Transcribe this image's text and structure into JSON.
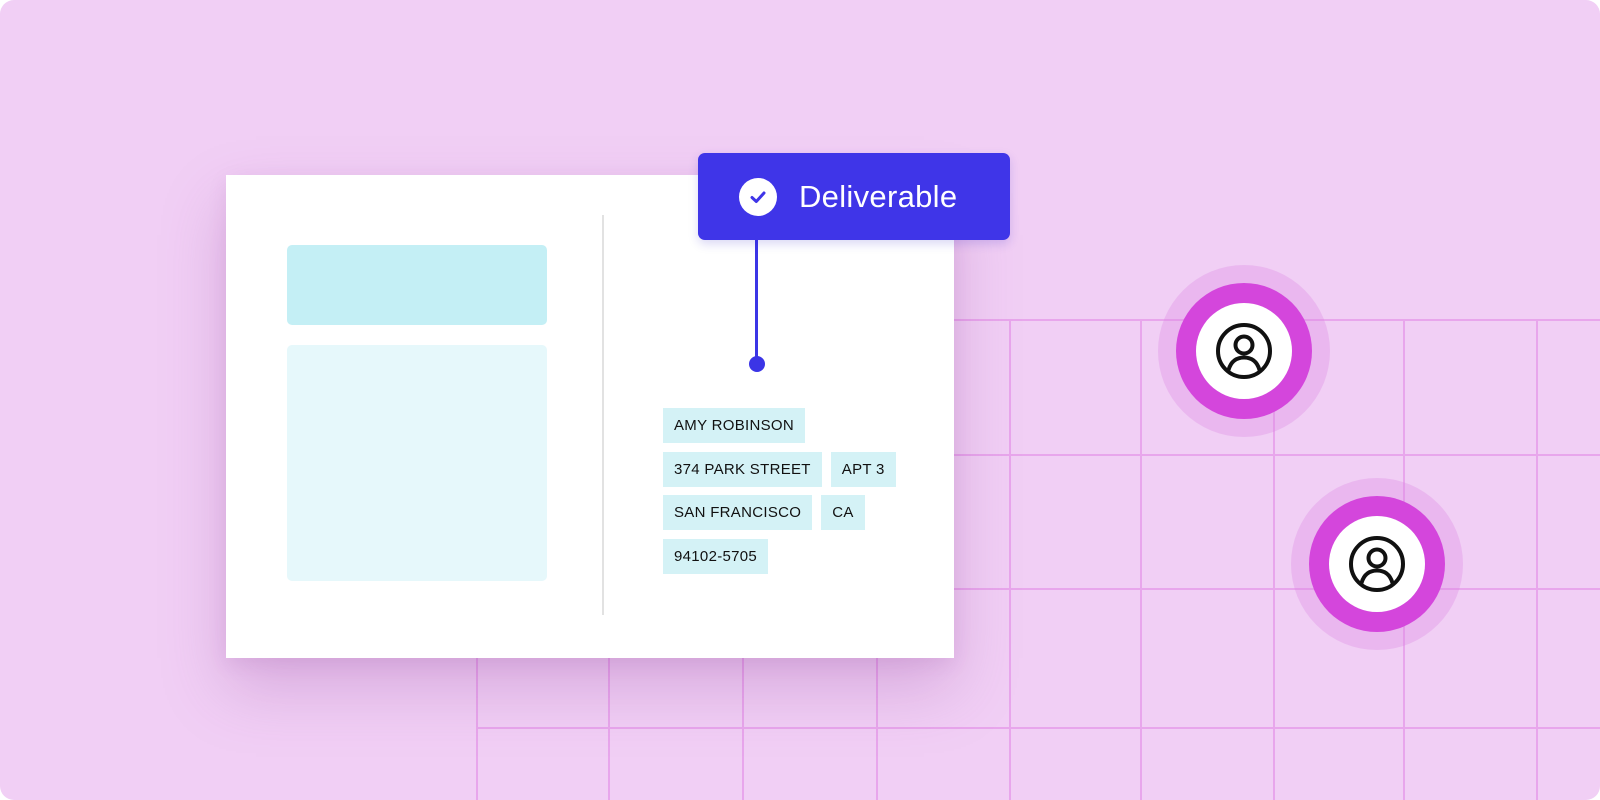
{
  "status": {
    "label": "Deliverable",
    "icon": "check-circle-icon",
    "color": "#3f35e8"
  },
  "address": {
    "name": "AMY ROBINSON",
    "street": "374 PARK STREET",
    "unit": "APT 3",
    "city": "SAN FRANCISCO",
    "state": "CA",
    "zip": "94102-5705"
  },
  "map": {
    "markers": [
      {
        "icon": "user-icon"
      },
      {
        "icon": "user-icon"
      }
    ]
  },
  "colors": {
    "background": "#f1cff5",
    "grid": "#e8a6ec",
    "marker": "#d446dc",
    "chip": "#d4f2f6"
  }
}
